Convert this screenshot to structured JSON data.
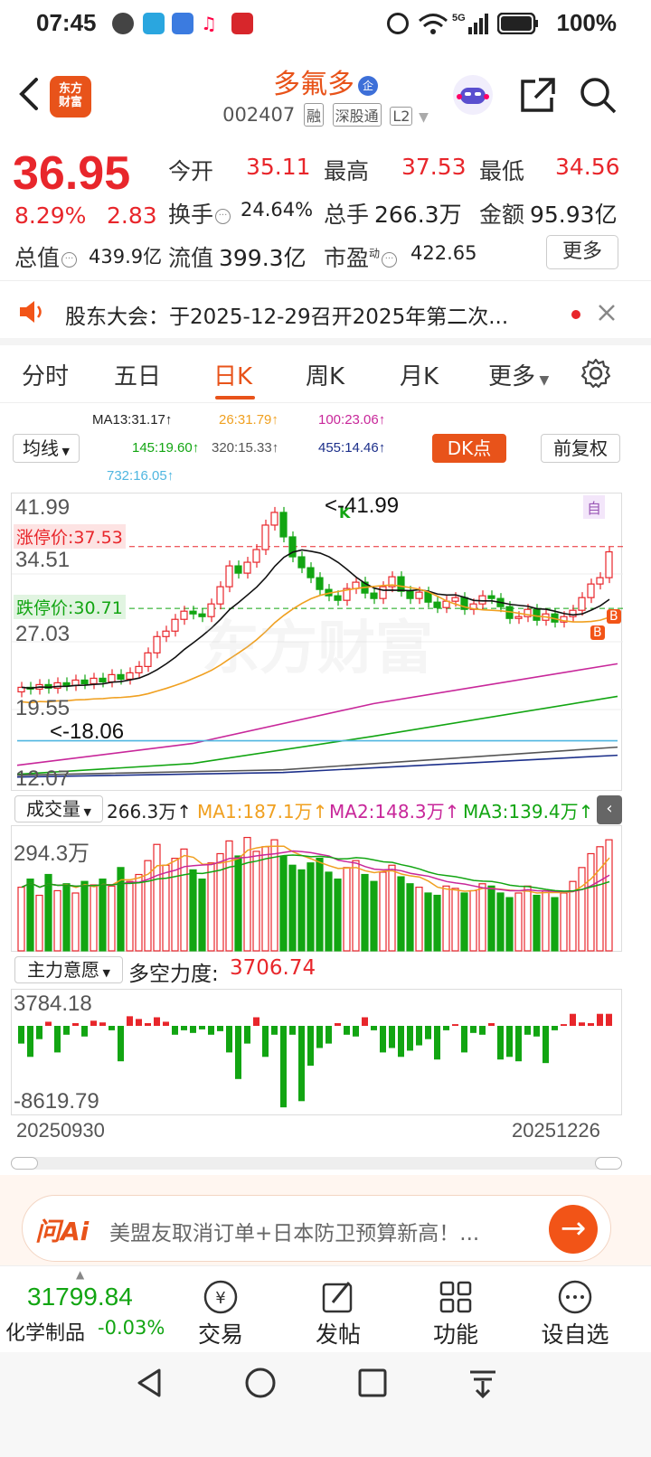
{
  "status": {
    "time": "07:45",
    "battery": "100%",
    "network": "5G"
  },
  "header": {
    "logo_text": "东方\n财富",
    "stock_name": "多氟多",
    "badge": "企",
    "code": "002407",
    "tags": [
      "融",
      "深股通",
      "L2"
    ]
  },
  "quote": {
    "price": "36.95",
    "change_pct": "8.29%",
    "change": "2.83",
    "open_label": "今开",
    "open": "35.11",
    "high_label": "最高",
    "high": "37.53",
    "low_label": "最低",
    "low": "34.56",
    "turnover_label": "换手",
    "turnover": "24.64%",
    "volume_label": "总手",
    "volume": "266.3万",
    "amount_label": "金额",
    "amount": "95.93亿",
    "mktcap_label": "总值",
    "mktcap": "439.9亿",
    "float_label": "流值",
    "float_cap": "399.3亿",
    "pe_label": "市盈",
    "pe_sup": "动",
    "pe": "422.65",
    "more": "更多"
  },
  "notice": {
    "text": "股东大会：于2025-12-29召开2025年第二次..."
  },
  "tabs": [
    {
      "label": "分时"
    },
    {
      "label": "五日"
    },
    {
      "label": "日K"
    },
    {
      "label": "周K"
    },
    {
      "label": "月K"
    },
    {
      "label": "更多"
    }
  ],
  "ma": {
    "ma13": "MA13:31.17↑",
    "ma26": "26:31.79↑",
    "ma100": "100:23.06↑",
    "ma145": "145:19.60↑",
    "ma320": "320:15.33↑",
    "ma455": "455:14.46↑",
    "ma732": "732:16.05↑",
    "selector": "均线",
    "dk": "DK点",
    "fq": "前复权"
  },
  "kchart": {
    "y_labels": [
      "41.99",
      "34.51",
      "27.03",
      "19.55",
      "12.07"
    ],
    "limit_up": "涨停价:37.53",
    "limit_down": "跌停价:30.71",
    "max_note": "<-41.99",
    "min_note": "<-18.06",
    "k_mark": "K",
    "zi_mark": "自",
    "b_mark": "B",
    "watermark": "东方财富"
  },
  "volume": {
    "selector": "成交量",
    "value": "266.3万↑",
    "ma1": "MA1:187.1万↑",
    "ma2": "MA2:148.3万↑",
    "ma3": "MA3:139.4万↑",
    "top_label": "294.3万"
  },
  "fund": {
    "selector": "主力意愿",
    "label": "多空力度:",
    "value": "3706.74",
    "top_label": "3784.18",
    "bottom_label": "-8619.79"
  },
  "dates": {
    "start": "20250930",
    "end": "20251226"
  },
  "ai": {
    "logo": "问Ai",
    "text": "美盟友取消订单+日本防卫预算新高！..."
  },
  "toolbar": {
    "index_value": "31799.84",
    "index_name": "化学制品",
    "index_change": "-0.03%",
    "items": [
      {
        "label": "交易"
      },
      {
        "label": "发帖"
      },
      {
        "label": "功能"
      },
      {
        "label": "设自选"
      }
    ]
  },
  "colors": {
    "up": "#e8262b",
    "down": "#12a512",
    "accent": "#e8531a"
  }
}
